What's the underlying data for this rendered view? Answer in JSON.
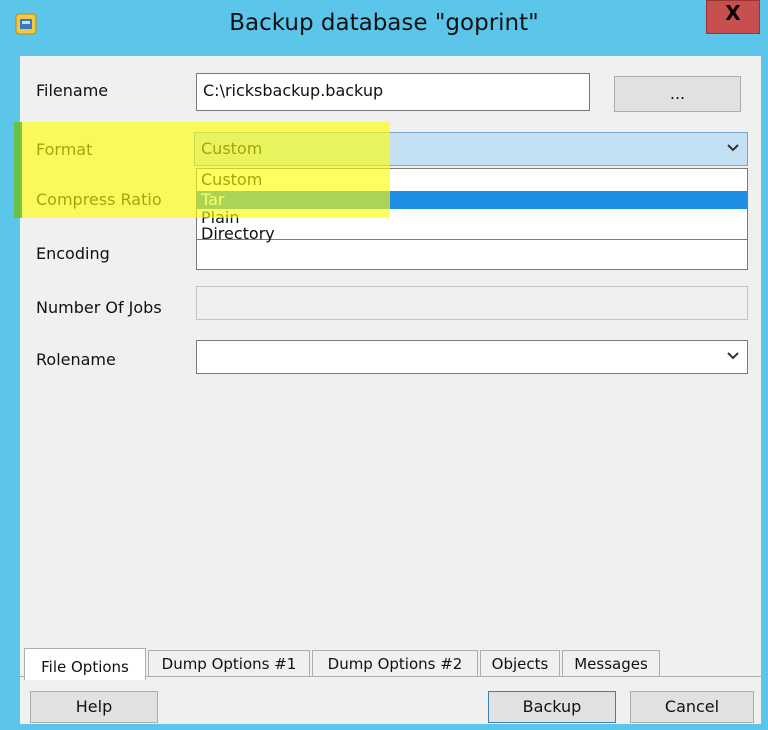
{
  "window": {
    "title": "Backup database \"goprint\"",
    "close_label": "X",
    "accent": "#5cc6ea"
  },
  "fields": {
    "filename": {
      "label": "Filename",
      "value": "C:\\ricksbackup.backup"
    },
    "browse_label": "...",
    "format": {
      "label": "Format",
      "value": "Custom"
    },
    "compress_ratio": {
      "label": "Compress Ratio"
    },
    "encoding": {
      "label": "Encoding"
    },
    "number_of_jobs": {
      "label": "Number Of Jobs"
    },
    "rolename": {
      "label": "Rolename",
      "value": ""
    }
  },
  "format_dropdown": {
    "options": [
      "Custom",
      "Tar",
      "Plain",
      "Directory"
    ],
    "highlighted": "Tar"
  },
  "tabs": [
    {
      "label": "File Options",
      "active": true
    },
    {
      "label": "Dump Options #1",
      "active": false
    },
    {
      "label": "Dump Options #2",
      "active": false
    },
    {
      "label": "Objects",
      "active": false
    },
    {
      "label": "Messages",
      "active": false
    }
  ],
  "buttons": {
    "help": "Help",
    "backup": "Backup",
    "cancel": "Cancel"
  },
  "icons": {
    "app": "database-icon",
    "dropdown": "chevron-down-icon"
  },
  "colors": {
    "titlebar": "#5cc6ea",
    "close": "#c7504f",
    "selection": "#3399ff",
    "highlight": "#ffff00"
  }
}
